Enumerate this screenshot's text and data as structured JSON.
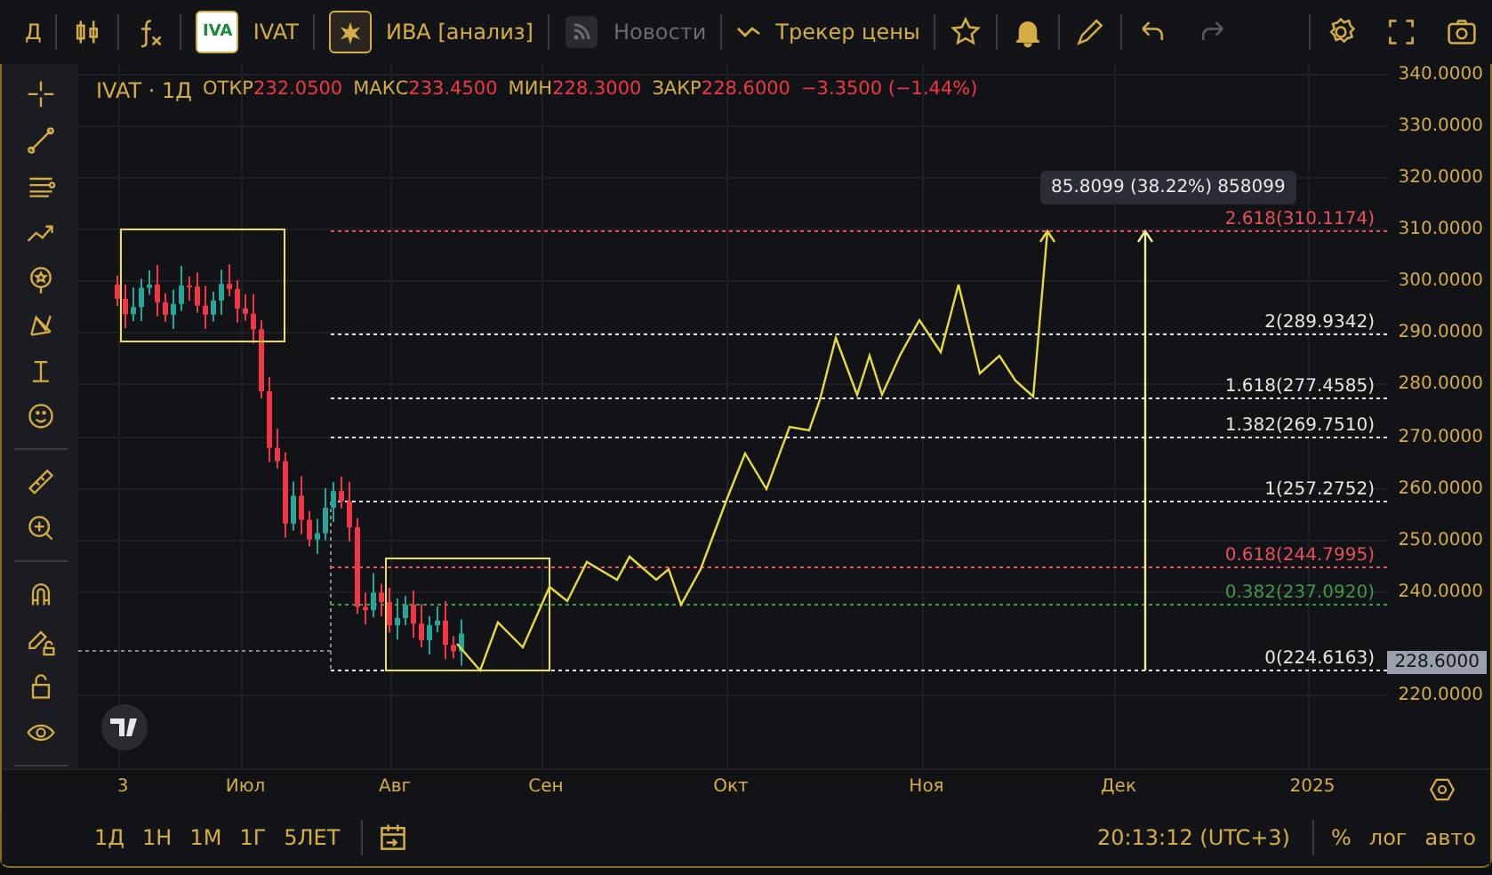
{
  "top_toolbar": {
    "interval": "Д",
    "symbol_logo": "IVA",
    "symbol": "IVAT",
    "indicator": "ИВА [анализ]",
    "news": {
      "label": "Новости",
      "disabled": true
    },
    "price_tracker": "Трекер цены",
    "alert_active": true,
    "redo_disabled": true
  },
  "legend": {
    "symbol": "IVAT · 1Д",
    "fields": [
      {
        "label": "ОТКР",
        "value": "232.0500"
      },
      {
        "label": "МАКС",
        "value": "233.4500"
      },
      {
        "label": "МИН",
        "value": "228.3000"
      },
      {
        "label": "ЗАКР",
        "value": "228.6000"
      }
    ],
    "change": "−3.3500 (−1.44%)"
  },
  "price_axis": {
    "ticks": [
      "340.0000",
      "330.0000",
      "320.0000",
      "310.0000",
      "300.0000",
      "290.0000",
      "280.0000",
      "270.0000",
      "260.0000",
      "250.0000",
      "240.0000",
      "220.0000"
    ],
    "last_price": "228.6000"
  },
  "fib_levels": [
    {
      "label": "2.618(310.1174)",
      "color": "#e8505c"
    },
    {
      "label": "2(289.9342)",
      "color": "#e6e6e6"
    },
    {
      "label": "1.618(277.4585)",
      "color": "#e6e6e6"
    },
    {
      "label": "1.382(269.7510)",
      "color": "#e6e6e6"
    },
    {
      "label": "1(257.2752)",
      "color": "#e6e6e6"
    },
    {
      "label": "0.618(244.7995)",
      "color": "#e8505c"
    },
    {
      "label": "0.382(237.0920)",
      "color": "#3f9a4a"
    },
    {
      "label": "0(224.6163)",
      "color": "#e6e6e6"
    }
  ],
  "measure_tooltip": "85.8099 (38.22%) 858099",
  "time_axis": {
    "labels": [
      "3",
      "Июл",
      "Авг",
      "Сен",
      "Окт",
      "Ноя",
      "Дек",
      "2025"
    ]
  },
  "bottom_bar": {
    "ranges": [
      "1Д",
      "1Н",
      "1М",
      "1Г",
      "5ЛЕТ"
    ],
    "clock": "20:13:12 (UTC+3)",
    "percent": "%",
    "log": "лог",
    "auto": "авто"
  }
}
